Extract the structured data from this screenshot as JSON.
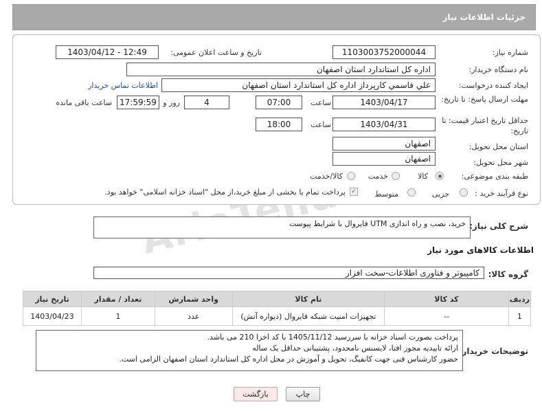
{
  "header": {
    "title": "جزئیات اطلاعات نیاز"
  },
  "form": {
    "need_number_label": "شماره نیاز:",
    "need_number": "1103003752000044",
    "announce_label": "تاریخ و ساعت اعلان عمومی:",
    "announce_value": "1403/04/12 - 12:49",
    "buyer_org_label": "نام دستگاه خریدار:",
    "buyer_org": "اداره کل استاندارد استان اصفهان",
    "requester_label": "ایجاد کننده درخواست:",
    "requester": "علي قاسمي كارپرداز اداره كل استاندارد استان اصفهان",
    "contact_link": "اطلاعات تماس خریدار",
    "deadline_label": "مهلت ارسال پاسخ: تا تاریخ:",
    "deadline_date": "1403/04/17",
    "time_label": "ساعت",
    "deadline_time": "07:00",
    "days_value": "4",
    "days_label": "روز و",
    "remaining_time": "17:59:59",
    "remaining_label": "ساعت باقی مانده",
    "validity_label": "حداقل تاریخ اعتبار قیمت: تا تاریخ:",
    "validity_date": "1403/04/31",
    "validity_time": "18:00",
    "province_label": "استان محل تحویل:",
    "province": "اصفهان",
    "city_label": "شهر محل تحویل:",
    "city": "اصفهان",
    "category_label": "طبقه بندی موضوعی:",
    "category_options": [
      "کالا",
      "خدمت",
      "کالا/خدمت"
    ],
    "category_selected": "کالا",
    "process_label": "نوع فرآیند خرید :",
    "process_options": [
      "جزیی",
      "متوسط"
    ],
    "process_note": "پرداخت تمام یا بخشی از مبلغ خرید،از محل \"اسناد خزانه اسلامی\" خواهد بود."
  },
  "summary": {
    "label": "شرح کلی نیاز:",
    "text": "خرید، نصب و راه اندازی UTM فایروال با شرایط پیوست"
  },
  "goods_info": {
    "title": "اطلاعات کالاهای مورد نیاز",
    "group_label": "گروه کالا:",
    "group_value": "کامپیوتر و فناوری اطلاعات-سخت افزار"
  },
  "table": {
    "headers": [
      "ردیف",
      "کد کالا",
      "نام کالا",
      "واحد شمارش",
      "تعداد / مقدار",
      "تاریخ نیاز"
    ],
    "rows": [
      [
        "1",
        "--",
        "تجهیزات امنیت شبکه فایروال (دیواره آتش)",
        "عدد",
        "1",
        "1403/04/23"
      ]
    ]
  },
  "buyer_notes": {
    "label": "توضیحات خریدار:",
    "lines": [
      "پرداخت بصورت اسناد خزانه با سررسید 1405/11/12 با کد اخزا 210 می باشد.",
      "ارائه تاییدیه مجوز افتا، لایسنس نامحدود، پشتیبانی حداقل یک ساله",
      "حضور کارشناس فنی جهت کانفیگ، تحویل و آموزش در محل اداره کل استاندارد استان اصفهان الزامی است."
    ]
  },
  "buttons": {
    "print": "چاپ",
    "back": "بازگشت"
  },
  "watermark": "AriaTender.net"
}
